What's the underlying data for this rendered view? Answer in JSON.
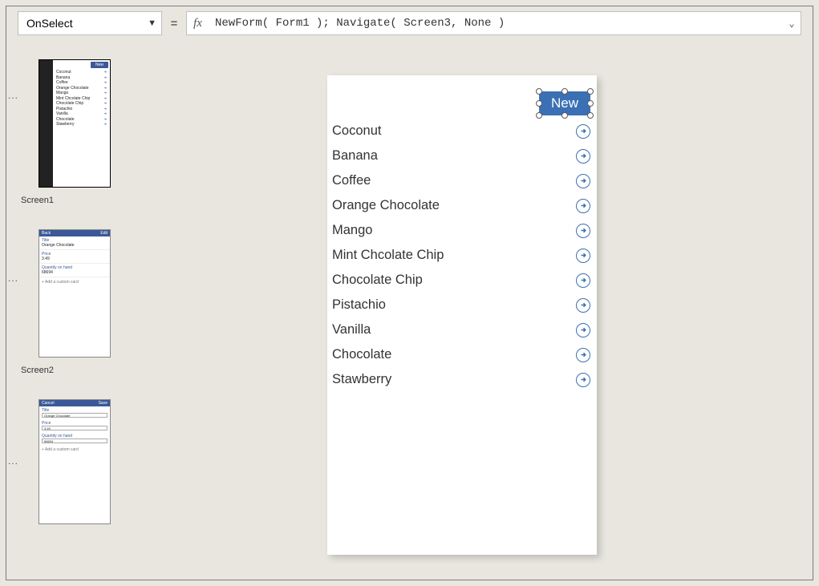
{
  "formula_bar": {
    "property": "OnSelect",
    "equals": "=",
    "fx": "fx",
    "formula": "NewForm( Form1 ); Navigate( Screen3, None )"
  },
  "screens_panel": {
    "ellipsis": "...",
    "screens": [
      {
        "name": "Screen1"
      },
      {
        "name": "Screen2"
      },
      {
        "name": ""
      }
    ],
    "thumb1": {
      "new_btn": "New",
      "items": [
        "Coconut",
        "Banana",
        "Coffee",
        "Orange Chocolate",
        "Mango",
        "Mint Chcolate Chip",
        "Chocolate Chip",
        "Pistachio",
        "Vanilla",
        "Chocolate",
        "Stawberry"
      ]
    },
    "thumb2": {
      "back": "Back",
      "edit": "Edit",
      "title_lbl": "Title",
      "title_val": "Orange Chocolate",
      "price_lbl": "Price",
      "price_val": "3.49",
      "qty_lbl": "Quantity on hand",
      "qty_val": "68694",
      "addcard": "+  Add a custom card"
    },
    "thumb3": {
      "cancel": "Cancel",
      "save": "Save",
      "title_lbl": "Title",
      "title_val": "Orange Chocolate",
      "price_lbl": "Price",
      "price_val": "3.49",
      "qty_lbl": "Quantity on hand",
      "qty_val": "68694",
      "addcard": "+  Add a custom card"
    }
  },
  "canvas": {
    "new_button": "New",
    "items": [
      "Coconut",
      "Banana",
      "Coffee",
      "Orange Chocolate",
      "Mango",
      "Mint Chcolate Chip",
      "Chocolate Chip",
      "Pistachio",
      "Vanilla",
      "Chocolate",
      "Stawberry"
    ]
  }
}
